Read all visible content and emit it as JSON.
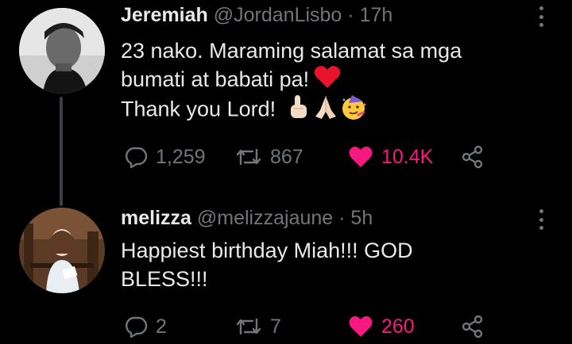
{
  "tweets": [
    {
      "name": "Jeremiah",
      "handle": "@JordanLisbo",
      "separator": "·",
      "time": "17h",
      "lines": [
        "23 nako. Maraming salamat sa mga",
        "bumati at babati pa!",
        "Thank you Lord!"
      ],
      "replies": "1,259",
      "retweets": "867",
      "likes": "10.4K",
      "liked": true,
      "emojis": [
        "red-heart",
        "pointing-up",
        "folded-hands",
        "partying-face"
      ]
    },
    {
      "name": "melizza",
      "handle": "@melizzajaune",
      "separator": "·",
      "time": "5h",
      "lines": [
        "Happiest birthday Miah!!! GOD",
        "BLESS!!!"
      ],
      "replies": "2",
      "retweets": "7",
      "likes": "260",
      "liked": true
    }
  ],
  "colors": {
    "background": "#000000",
    "text": "#e7e9ea",
    "muted": "#71767b",
    "like": "#f91880",
    "thread_line": "#3a3f44"
  }
}
